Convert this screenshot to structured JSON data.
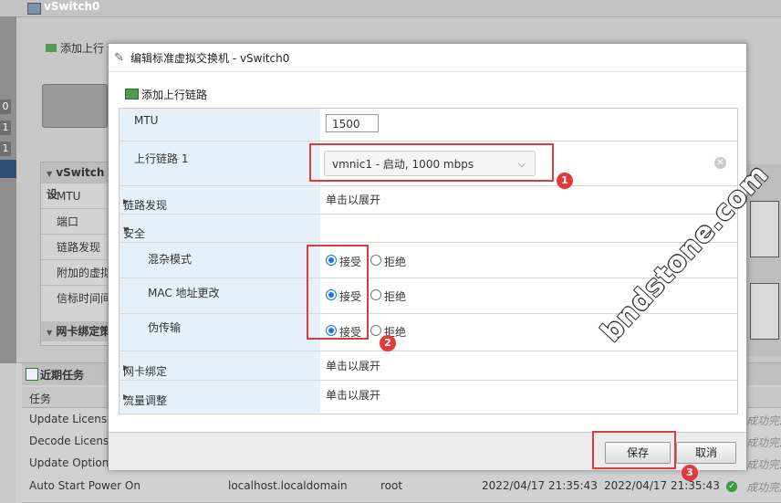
{
  "background": {
    "window_title": "vSwitch0",
    "add_uplink_label": "添加上行",
    "left_numbers": [
      "0",
      "1",
      "1"
    ],
    "panel": {
      "header": "vSwitch 设",
      "rows": [
        "MTU",
        "端口",
        "链路发现",
        "附加的虚拟",
        "信标时间间"
      ],
      "header2": "网卡绑定策"
    },
    "tasks": {
      "title": "近期任务",
      "column_task": "任务",
      "rows": [
        {
          "name": "Update License",
          "target": "",
          "user": "",
          "queued": "",
          "started": "",
          "result": "成功完成"
        },
        {
          "name": "Decode License",
          "target": "",
          "user": "",
          "queued": "",
          "started": "",
          "result": "成功完成"
        },
        {
          "name": "Update Options",
          "target": "",
          "user": "",
          "queued": "",
          "started": "",
          "result": "成功完成"
        },
        {
          "name": "Auto Start Power On",
          "target": "localhost.localdomain",
          "user": "root",
          "queued": "2022/04/17 21:35:43",
          "started": "2022/04/17 21:35:43",
          "result": "成功完成"
        }
      ]
    }
  },
  "dialog": {
    "title": "编辑标准虚拟交换机 - vSwitch0",
    "add_uplink": "添加上行链路",
    "mtu": {
      "label": "MTU",
      "value": "1500"
    },
    "uplink": {
      "label": "上行链路 1",
      "selected": "vmnic1 - 启动, 1000 mbps"
    },
    "link_discovery": {
      "label": "链路发现",
      "value": "单击以展开"
    },
    "security": {
      "label": "安全",
      "options": {
        "accept": "接受",
        "reject": "拒绝"
      },
      "promiscuous": {
        "label": "混杂模式",
        "value": "accept"
      },
      "mac_change": {
        "label": "MAC 地址更改",
        "value": "accept"
      },
      "forged": {
        "label": "伪传输",
        "value": "accept"
      }
    },
    "nic_teaming": {
      "label": "网卡绑定",
      "value": "单击以展开"
    },
    "traffic_shaping": {
      "label": "流量调整",
      "value": "单击以展开"
    },
    "save_label": "保存",
    "cancel_label": "取消"
  },
  "annotations": {
    "badge1": "1",
    "badge2": "2",
    "badge3": "3",
    "highlight_color": "#e23a3a"
  },
  "watermark": "bndstone.com"
}
